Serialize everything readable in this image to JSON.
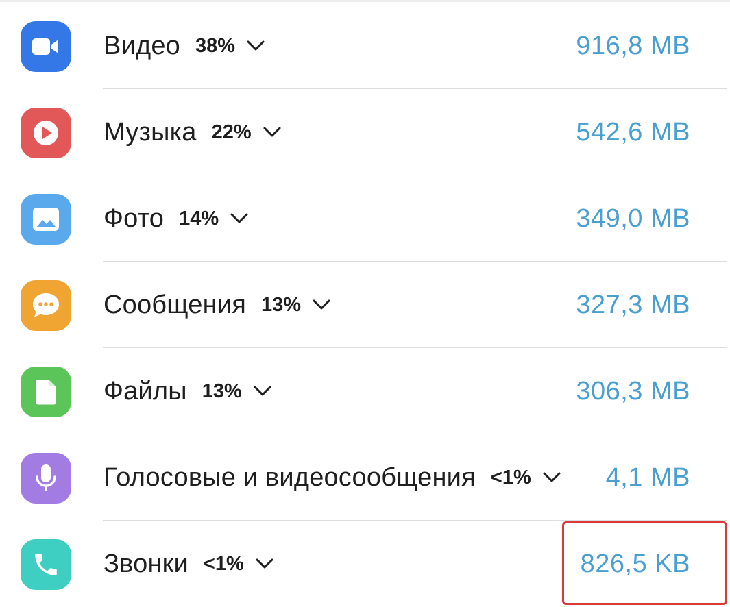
{
  "storage_list": {
    "items": [
      {
        "id": "video",
        "name": "Видео",
        "percent": "38%",
        "size": "916,8 MB",
        "icon": "video-camera-icon",
        "color": "#3478e8"
      },
      {
        "id": "music",
        "name": "Музыка",
        "percent": "22%",
        "size": "542,6 MB",
        "icon": "play-icon",
        "color": "#e25858"
      },
      {
        "id": "photo",
        "name": "Фото",
        "percent": "14%",
        "size": "349,0 MB",
        "icon": "image-icon",
        "color": "#5aa9ec"
      },
      {
        "id": "messages",
        "name": "Сообщения",
        "percent": "13%",
        "size": "327,3 MB",
        "icon": "chat-bubble-icon",
        "color": "#f0a431"
      },
      {
        "id": "files",
        "name": "Файлы",
        "percent": "13%",
        "size": "306,3 MB",
        "icon": "document-icon",
        "color": "#5cc55a"
      },
      {
        "id": "voice",
        "name": "Голосовые и видеосообщения",
        "percent": "<1%",
        "size": "4,1 MB",
        "icon": "microphone-icon",
        "color": "#a27be3"
      },
      {
        "id": "calls",
        "name": "Звонки",
        "percent": "<1%",
        "size": "826,5 KB",
        "icon": "phone-icon",
        "color": "#3fcfc2"
      }
    ]
  },
  "colors": {
    "size_text": "#4a9fd1",
    "highlight": "#d93a3a"
  }
}
